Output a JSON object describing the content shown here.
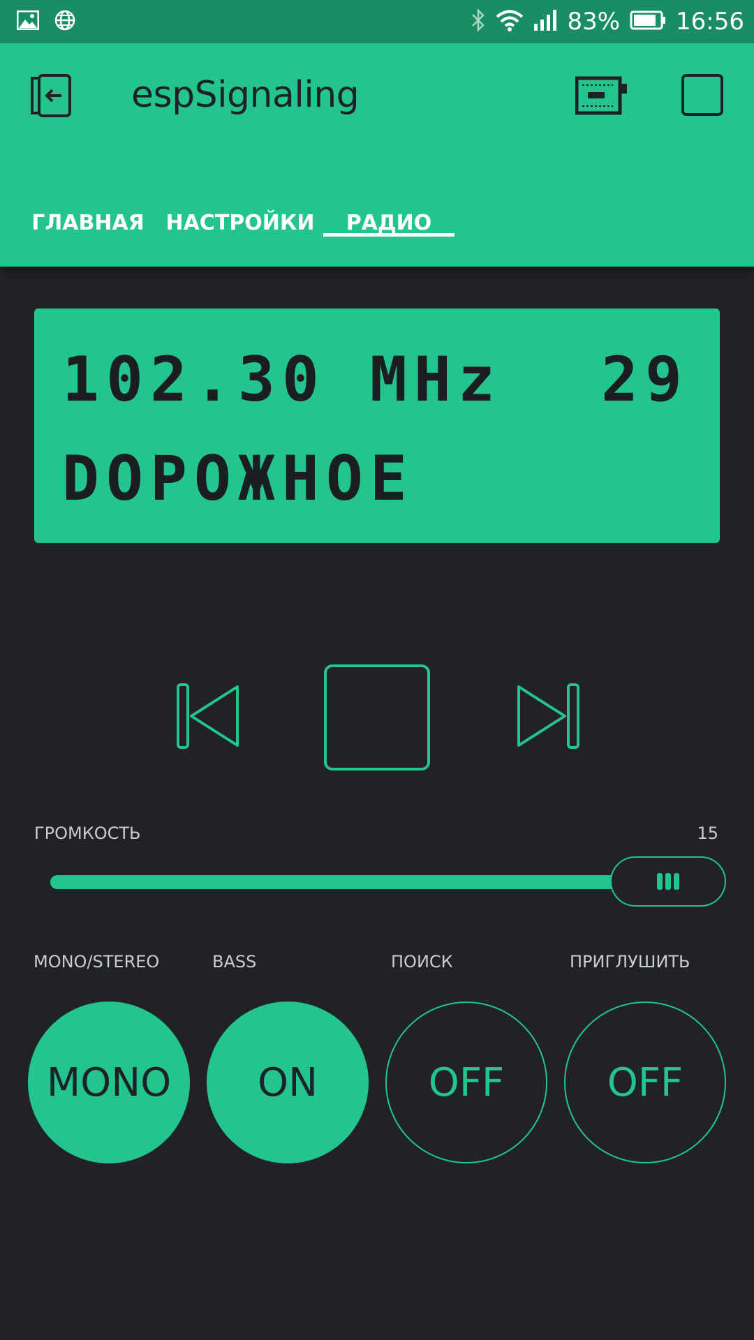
{
  "status_bar": {
    "battery": "83%",
    "time": "16:56"
  },
  "app": {
    "title": "espSignaling"
  },
  "tabs": [
    {
      "label": "ГЛАВНАЯ",
      "active": false
    },
    {
      "label": "НАСТРОЙКИ",
      "active": false
    },
    {
      "label": "РАДИО",
      "active": true
    }
  ],
  "lcd": {
    "line1_left": "102.30 MHz",
    "line1_right": "29",
    "line2": "DOPOЖHOE"
  },
  "volume": {
    "label": "ГРОМКОСТЬ",
    "value": "15"
  },
  "toggles": [
    {
      "label": "MONO/STEREO",
      "button": "MONO",
      "state": "on"
    },
    {
      "label": "BASS",
      "button": "ON",
      "state": "on"
    },
    {
      "label": "ПОИСК",
      "button": "OFF",
      "state": "off"
    },
    {
      "label": "ПРИГЛУШИТЬ",
      "button": "OFF",
      "state": "off"
    }
  ],
  "colors": {
    "accent": "#23c58c",
    "background": "#212227",
    "status_bar": "#198d63"
  }
}
